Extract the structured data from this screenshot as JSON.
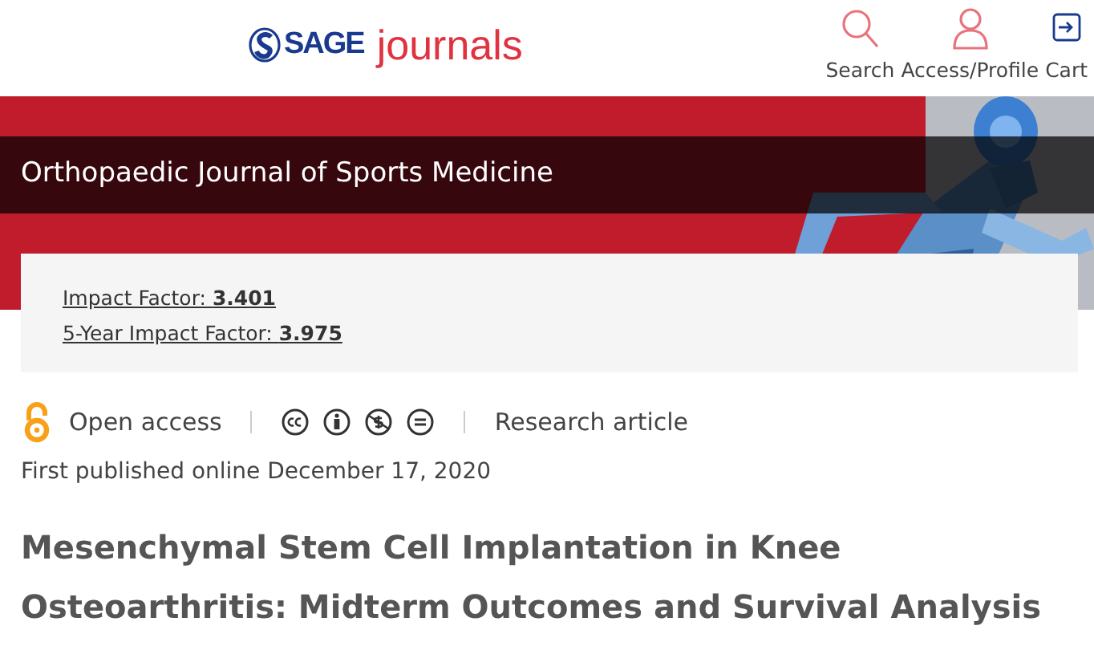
{
  "header": {
    "logo": {
      "brand": "SAGE",
      "product": "journals"
    },
    "nav": [
      {
        "kind": "search",
        "label": "Search"
      },
      {
        "kind": "profile",
        "label": "Access/Profile"
      },
      {
        "kind": "cart",
        "label": "Cart"
      }
    ]
  },
  "banner": {
    "journal_title": "Orthopaedic Journal of Sports Medicine"
  },
  "metrics": [
    "Impact Factor: **3.401**",
    "5-Year Impact Factor: **3.975**"
  ],
  "article": {
    "access": "Open access",
    "type": "Research article",
    "published": "First published online December 17, 2020",
    "title": "Mesenchymal Stem Cell Implantation in Knee Osteoarthritis: Midterm Outcomes and Survival Analysis"
  }
}
